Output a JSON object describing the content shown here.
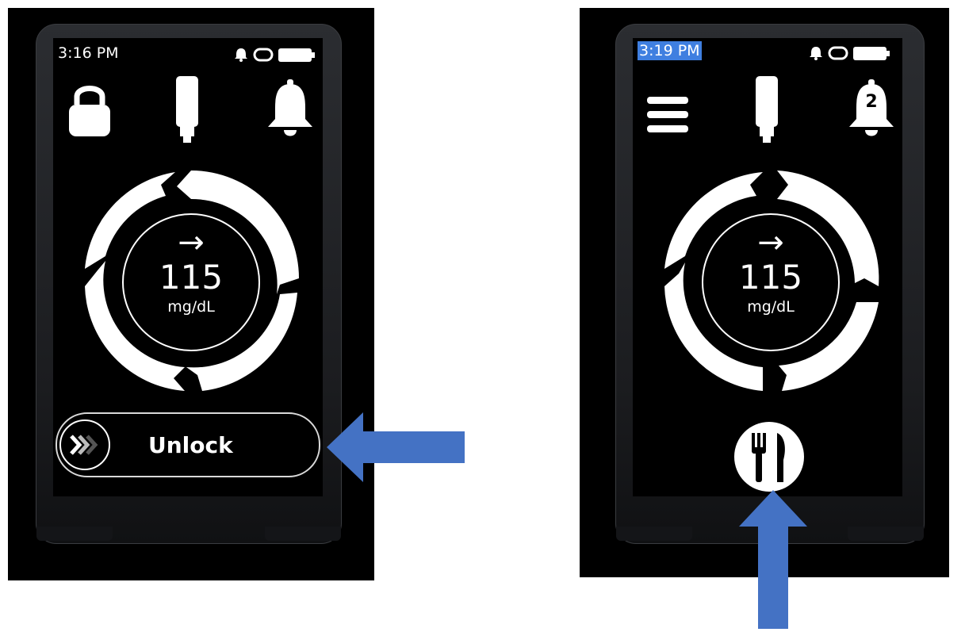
{
  "left_screen": {
    "time": "3:16 PM",
    "reading": {
      "trend_arrow": "→",
      "value": "115",
      "unit": "mg/dL"
    },
    "unlock_label": "Unlock",
    "left_icon": "lock-icon",
    "center_icon": "sensor-icon",
    "right_icon": "bell-icon"
  },
  "right_screen": {
    "time": "3:19 PM",
    "reading": {
      "trend_arrow": "→",
      "value": "115",
      "unit": "mg/dL"
    },
    "notification_count": "2",
    "left_icon": "menu-icon",
    "center_icon": "sensor-icon",
    "right_icon": "bell-icon",
    "bottom_button_icon": "fork-knife-icon"
  },
  "colors": {
    "callout_arrow": "#4472c4",
    "time_highlight": "#3f7fe0",
    "screen_background": "#000000",
    "foreground": "#ffffff"
  }
}
